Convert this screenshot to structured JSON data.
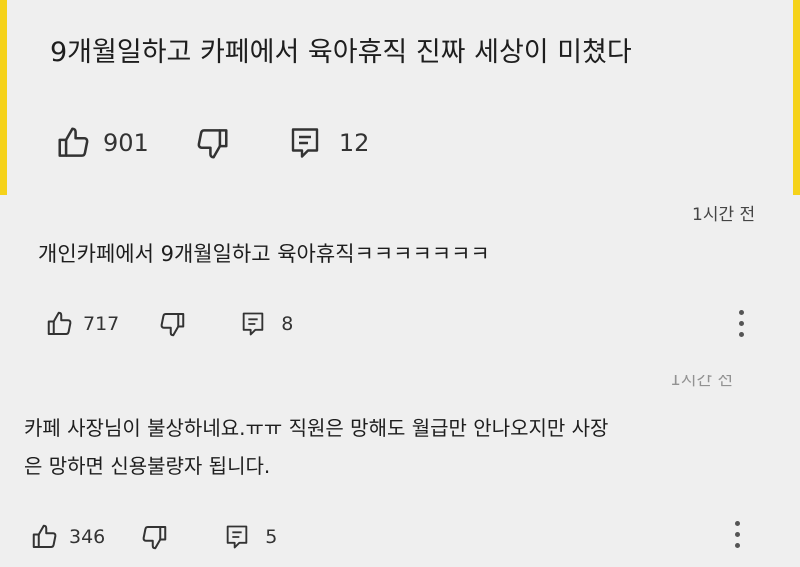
{
  "comments": [
    {
      "text": "9개월일하고 카페에서 육아휴직 진짜 세상이 미쳤다",
      "likes": "901",
      "replies": "12"
    },
    {
      "time": "1시간 전",
      "text": "개인카페에서 9개월일하고 육아휴직ㅋㅋㅋㅋㅋㅋㅋ",
      "likes": "717",
      "replies": "8"
    },
    {
      "time": "1시간 전",
      "text_line1": "카페 사장님이 불상하네요.ㅠㅠ 직원은 망해도 월급만 안나오지만 사장",
      "text_line2": "은 망하면 신용불량자 됩니다.",
      "likes": "346",
      "replies": "5"
    }
  ],
  "colors": {
    "accent_yellow": "#f5d21a",
    "background": "#efefef"
  },
  "icons": [
    "thumbs-up-icon",
    "thumbs-down-icon",
    "reply-icon",
    "more-vertical-icon"
  ]
}
